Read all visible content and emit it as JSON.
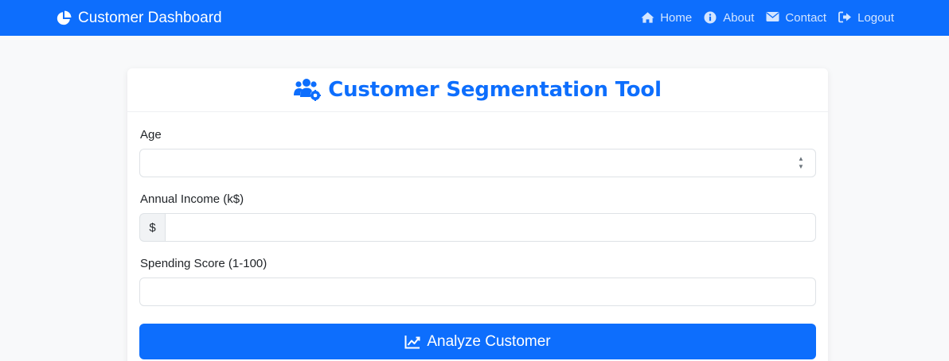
{
  "navbar": {
    "brand": {
      "label": "Customer Dashboard",
      "icon": "pie-chart-icon"
    },
    "links": [
      {
        "label": "Home",
        "icon": "home-icon"
      },
      {
        "label": "About",
        "icon": "info-circle-icon"
      },
      {
        "label": "Contact",
        "icon": "envelope-icon"
      },
      {
        "label": "Logout",
        "icon": "sign-out-icon"
      }
    ],
    "color": "#0d6efd"
  },
  "card": {
    "title": "Customer Segmentation Tool",
    "title_icon": "users-cog-icon",
    "fields": {
      "age": {
        "label": "Age",
        "value": "",
        "type": "number"
      },
      "income": {
        "label": "Annual Income (k$)",
        "prefix": "$",
        "value": ""
      },
      "spending": {
        "label": "Spending Score (1-100)",
        "value": ""
      }
    },
    "submit": {
      "label": "Analyze Customer",
      "icon": "chart-line-icon"
    }
  },
  "colors": {
    "primary": "#0d6efd",
    "background": "#f8f9fa"
  }
}
